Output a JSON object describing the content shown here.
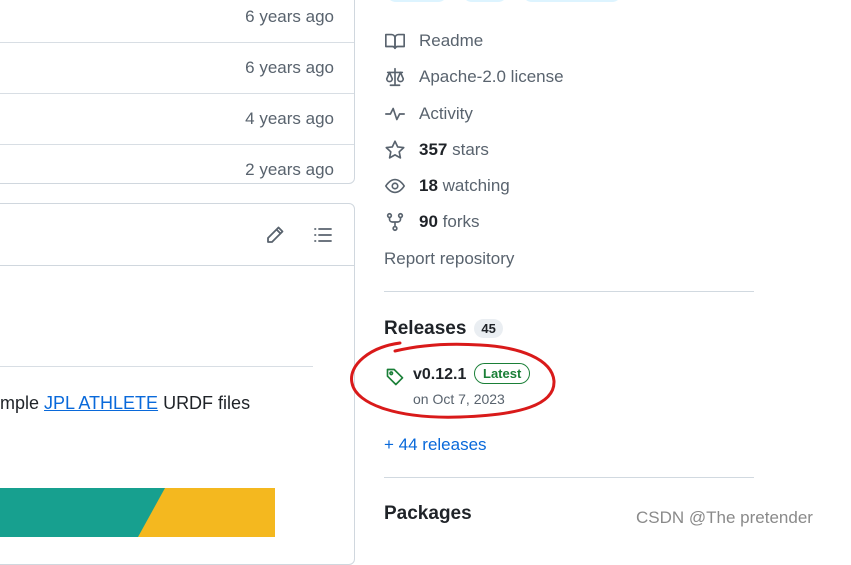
{
  "file_list": {
    "ages": [
      "6 years ago",
      "6 years ago",
      "4 years ago",
      "2 years ago"
    ]
  },
  "readme": {
    "text_before": "mple ",
    "link": "JPL ATHLETE",
    "text_after": " URDF files"
  },
  "about": {
    "readme_label": "Readme",
    "license_label": "Apache-2.0 license",
    "activity_label": "Activity",
    "stars_count": "357",
    "stars_label": " stars",
    "watching_count": "18",
    "watching_label": " watching",
    "forks_count": "90",
    "forks_label": " forks",
    "report_label": "Report repository"
  },
  "releases": {
    "title": "Releases",
    "count": "45",
    "latest_name": "v0.12.1",
    "latest_badge": "Latest",
    "latest_date": "on Oct 7, 2023",
    "more_link": "+ 44 releases"
  },
  "packages": {
    "title": "Packages"
  },
  "watermark": "CSDN @The  pretender",
  "colors": {
    "accent": "#0969da",
    "success": "#1a7f37",
    "annotation_red": "#d91a1a"
  }
}
